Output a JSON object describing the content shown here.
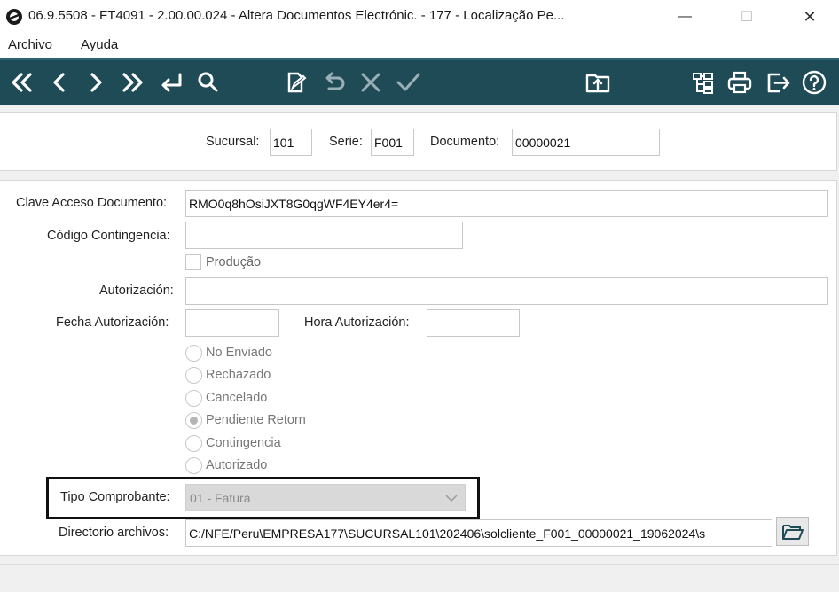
{
  "window": {
    "title": "06.9.5508 - FT4091 - 2.00.00.024 - Altera Documentos Electrónic. - 177 - Localização Pe...",
    "minimize": "—",
    "maximize": "☐",
    "close": "✕"
  },
  "menu": {
    "items": [
      "Archivo",
      "Ayuda"
    ]
  },
  "toolbar": {
    "colors": {
      "background": "#1f4b57",
      "icon": "#ffffff"
    },
    "buttons": [
      "first-icon",
      "previous-icon",
      "next-icon",
      "last-icon",
      "enter-icon",
      "search-icon",
      "edit-document-icon",
      "undo-icon",
      "cancel-icon",
      "confirm-icon",
      "upload-folder-icon",
      "tree-icon",
      "print-icon",
      "exit-icon",
      "help-icon"
    ]
  },
  "header": {
    "sucursal_label": "Sucursal:",
    "sucursal_value": "101",
    "serie_label": "Serie:",
    "serie_value": "F001",
    "documento_label": "Documento:",
    "documento_value": "00000021"
  },
  "form": {
    "clave_label": "Clave Acceso Documento:",
    "clave_value": "RMO0q8hOsiJXT8G0qgWF4EY4er4=",
    "codigo_label": "Código Contingencia:",
    "codigo_value": "",
    "producao_label": "Produção",
    "producao_checked": false,
    "autorizacion_label": "Autorización:",
    "autorizacion_value": "",
    "fecha_label": "Fecha Autorización:",
    "fecha_value": "",
    "hora_label": "Hora Autorización:",
    "hora_value": "",
    "status_options": [
      "No Enviado",
      "Rechazado",
      "Cancelado",
      "Pendiente Retorn",
      "Contingencia",
      "Autorizado"
    ],
    "status_selected": "Pendiente Retorn",
    "tipo_label": "Tipo Comprobante:",
    "tipo_value": "01 - Fatura",
    "directorio_label": "Directorio archivos:",
    "directorio_value": "C:/NFE/Peru\\EMPRESA177\\SUCURSAL101\\202406\\solcliente_F001_00000021_19062024\\s"
  }
}
